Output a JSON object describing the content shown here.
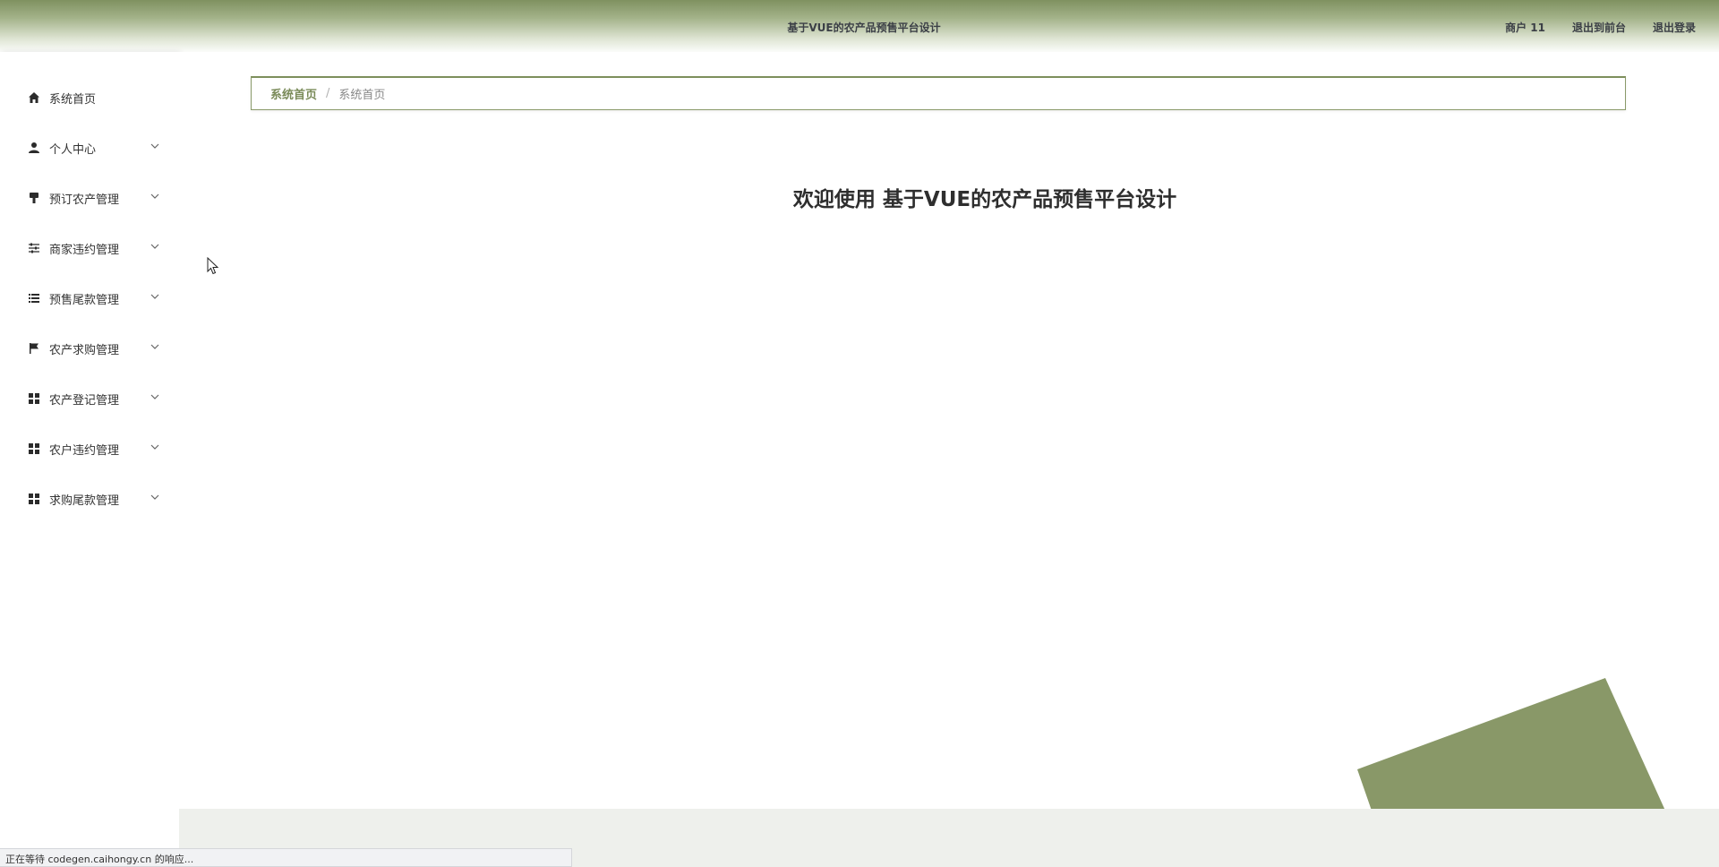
{
  "header": {
    "title": "基于VUE的农产品预售平台设计",
    "user_label": "商户 11",
    "to_front_label": "退出到前台",
    "logout_label": "退出登录"
  },
  "sidebar": {
    "items": [
      {
        "label": "系统首页",
        "icon": "home-icon"
      },
      {
        "label": "个人中心",
        "icon": "user-icon"
      },
      {
        "label": "预订农产管理",
        "icon": "brush-icon"
      },
      {
        "label": "商家违约管理",
        "icon": "sliders-icon"
      },
      {
        "label": "预售尾款管理",
        "icon": "list-icon"
      },
      {
        "label": "农产求购管理",
        "icon": "flag-icon"
      },
      {
        "label": "农产登记管理",
        "icon": "grid-icon"
      },
      {
        "label": "农户违约管理",
        "icon": "grid-icon"
      },
      {
        "label": "求购尾款管理",
        "icon": "grid-icon"
      }
    ]
  },
  "breadcrumb": {
    "first": "系统首页",
    "separator": "/",
    "current": "系统首页"
  },
  "main": {
    "welcome": "欢迎使用 基于VUE的农产品预售平台设计"
  },
  "status_bar": {
    "text": "正在等待 codegen.caihongy.cn 的响应..."
  },
  "colors": {
    "accent": "#8a9a6a",
    "header_top": "#7f9160",
    "decoration": "#899868"
  }
}
